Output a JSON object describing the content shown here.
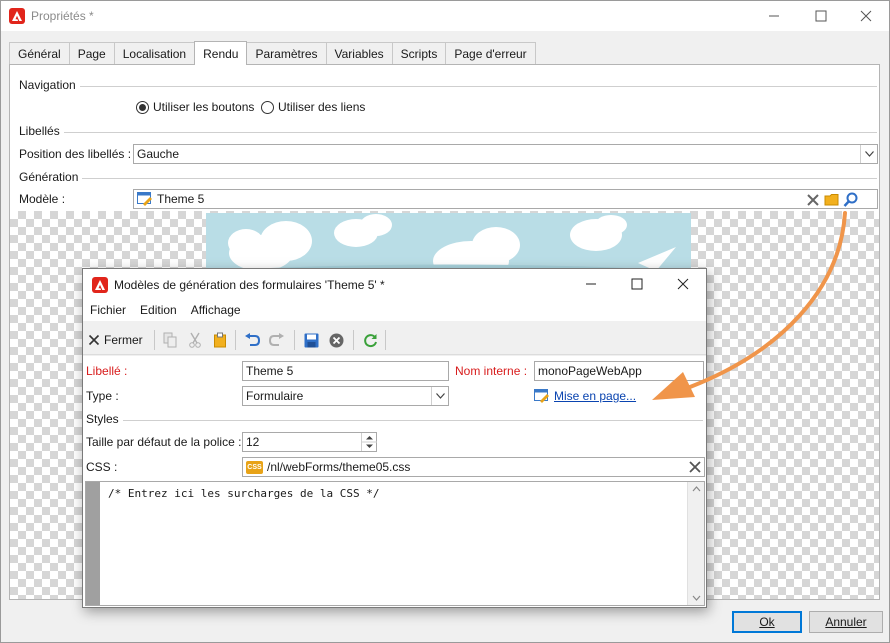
{
  "main_window": {
    "title": "Propriétés *",
    "tabs": [
      "Général",
      "Page",
      "Localisation",
      "Rendu",
      "Paramètres",
      "Variables",
      "Scripts",
      "Page d'erreur"
    ],
    "active_tab": "Rendu",
    "sections": {
      "navigation": "Navigation",
      "labels": "Libellés",
      "generation": "Génération"
    },
    "navigation_options": {
      "buttons": "Utiliser les boutons",
      "links": "Utiliser des liens",
      "selected": "buttons"
    },
    "label_position": {
      "label": "Position des libellés :",
      "value": "Gauche"
    },
    "template": {
      "label": "Modèle :",
      "value": "Theme 5"
    },
    "buttons": {
      "ok": "Ok",
      "cancel": "Annuler"
    }
  },
  "dialog": {
    "title": "Modèles de génération des formulaires 'Theme 5' *",
    "menu": [
      "Fichier",
      "Edition",
      "Affichage"
    ],
    "toolbar": {
      "close_label": "Fermer"
    },
    "fields": {
      "label": {
        "label": "Libellé :",
        "value": "Theme 5"
      },
      "internal_name": {
        "label": "Nom interne :",
        "value": "monoPageWebApp"
      },
      "type": {
        "label": "Type :",
        "value": "Formulaire"
      },
      "layout_link": "Mise en page...",
      "styles_section": "Styles",
      "font_size": {
        "label": "Taille par défaut de la police :",
        "value": "12"
      },
      "css": {
        "label": "CSS :",
        "value": "/nl/webForms/theme05.css",
        "badge": "CSS"
      }
    },
    "editor_text": "/* Entrez ici les surcharges de la CSS */"
  },
  "colors": {
    "accent_red": "#e1251b",
    "label_red": "#d81c1c",
    "arrow": "#f0954a",
    "link": "#0a44b0"
  }
}
